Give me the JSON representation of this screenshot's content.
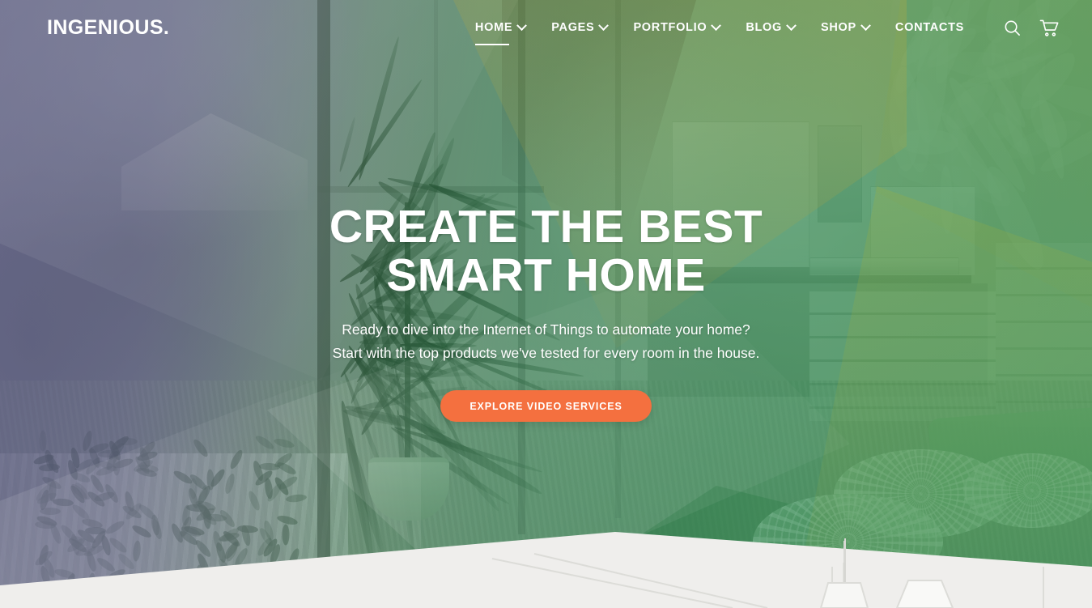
{
  "brand": {
    "logo": "INGENIOUS."
  },
  "nav": {
    "items": [
      {
        "label": "HOME",
        "has_caret": true,
        "active": true
      },
      {
        "label": "PAGES",
        "has_caret": true,
        "active": false
      },
      {
        "label": "PORTFOLIO",
        "has_caret": true,
        "active": false
      },
      {
        "label": "BLOG",
        "has_caret": true,
        "active": false
      },
      {
        "label": "SHOP",
        "has_caret": true,
        "active": false
      },
      {
        "label": "CONTACTS",
        "has_caret": false,
        "active": false
      }
    ],
    "icons": [
      {
        "name": "search-icon",
        "glyph": "search"
      },
      {
        "name": "cart-icon",
        "glyph": "cart"
      }
    ]
  },
  "hero": {
    "headline_line1": "CREATE THE BEST",
    "headline_line2": "SMART HOME",
    "subtitle_line1": "Ready to dive into the Internet of Things to automate your home?",
    "subtitle_line2": "Start with the top products we've tested for every room in the house.",
    "cta_label": "EXPLORE VIDEO SERVICES"
  },
  "colors": {
    "accent_orange": "#f4703f",
    "overlay_green": "#2e8a4e",
    "overlay_purple": "#606084",
    "bottom_section": "#efeeec",
    "text_light": "#ffffff"
  }
}
